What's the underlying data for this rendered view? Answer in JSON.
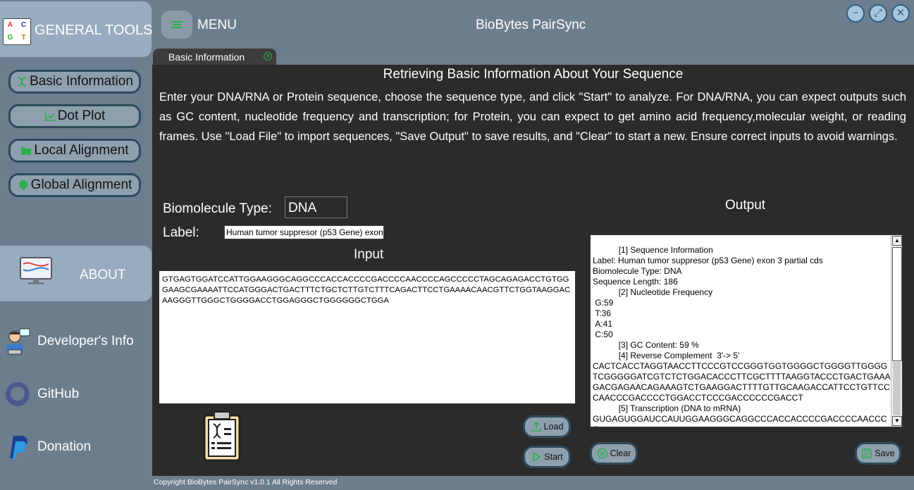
{
  "sidebar": {
    "brand_text": "GENERAL TOOLS",
    "brand_logo": [
      "A",
      "C",
      "G",
      "T"
    ],
    "items": [
      {
        "label": "Basic Information",
        "icon": "dna-icon"
      },
      {
        "label": "Dot Plot",
        "icon": "scatter-chart-icon"
      },
      {
        "label": "Local Alignment",
        "icon": "folder-icon"
      },
      {
        "label": "Global Alignment",
        "icon": "brain-icon"
      }
    ],
    "about_label": "ABOUT",
    "links": [
      {
        "label": "Developer's Info",
        "icon": "developer-icon"
      },
      {
        "label": "GitHub",
        "icon": "github-icon"
      },
      {
        "label": "Donation",
        "icon": "paypal-icon"
      }
    ]
  },
  "header": {
    "menu_label": "MENU",
    "title": "BioBytes PairSync"
  },
  "tab": {
    "label": "Basic Information"
  },
  "main": {
    "heading": "Retrieving Basic Information About Your Sequence",
    "description": "Enter your DNA/RNA or Protein sequence, choose the sequence type, and click \"Start\" to analyze. For DNA/RNA, you can expect outputs such as GC content, nucleotide frequency and transcription; for Protein, you can expect to get amino acid frequency,molecular weight, or reading frames. Use \"Load File\" to import sequences, \"Save Output\" to save results, and \"Clear\" to start a new. Ensure correct inputs to avoid warnings.",
    "biomolecule_label": "Biomolecule Type:",
    "biomolecule_value": "DNA",
    "label_label": "Label:",
    "label_value": "Human tumor suppresor (p53 Gene) exon",
    "input_title": "Input",
    "input_sequence": "GTGAGTGGATCCATTGGAAGGGCAGGCCCACCACCCCGACCCCAACCCCAGCCCCCTAGCAGAGACCTGTGGGAAGCGAAAATTCCATGGGACTGACTTTCTGCTCTTGTCTTTCAGACTTCCTGAAAACAACGTTCTGGTAAGGACAAGGGTTGGGCTGGGGACCTGGAGGGCTGGGGGGCTGGA",
    "output_title": "Output",
    "output_lines": [
      "           [1] Sequence Information",
      "Label: Human tumor suppresor (p53 Gene) exon 3 partial cds",
      "Biomolecule Type: DNA",
      "Sequence Length: 186",
      "           [2] Nucleotide Frequency",
      " G:59",
      " T:36",
      " A:41",
      " C:50",
      "           [3] GC Content: 59 %",
      "           [4] Reverse Complement  3'-> 5'",
      "CACTCACCTAGGTAACCTTCCCGTCCGGGTGGTGGGGCTGGGGTTGGGGTCGGGGGATCGTCTCTGGACACCCTTCGCTTTTAAGGTACCCTGACTGAAAGACGAGAACAGAAAGTCTGAAGGACTTTTGTTGCAAGACCATTCCTGTTCCCAACCCGACCCCTGGACCTCCCGACCCCCCGACCT",
      "           [5] Transcription (DNA to mRNA)",
      "GUGAGUGGAUCCAUUGGAAGGGCAGGCCCACCACCCCGACCCCAACCCC"
    ]
  },
  "buttons": {
    "load": "Load",
    "start": "Start",
    "clear": "Clear",
    "save": "Save"
  },
  "footer": "Copyright BioBytes PairSync v1.0.1 All Rights Reserved",
  "colors": {
    "accent_border": "#2e4a5c",
    "button_bg": "#8ea0ae",
    "green_icon": "#2ab04a"
  }
}
